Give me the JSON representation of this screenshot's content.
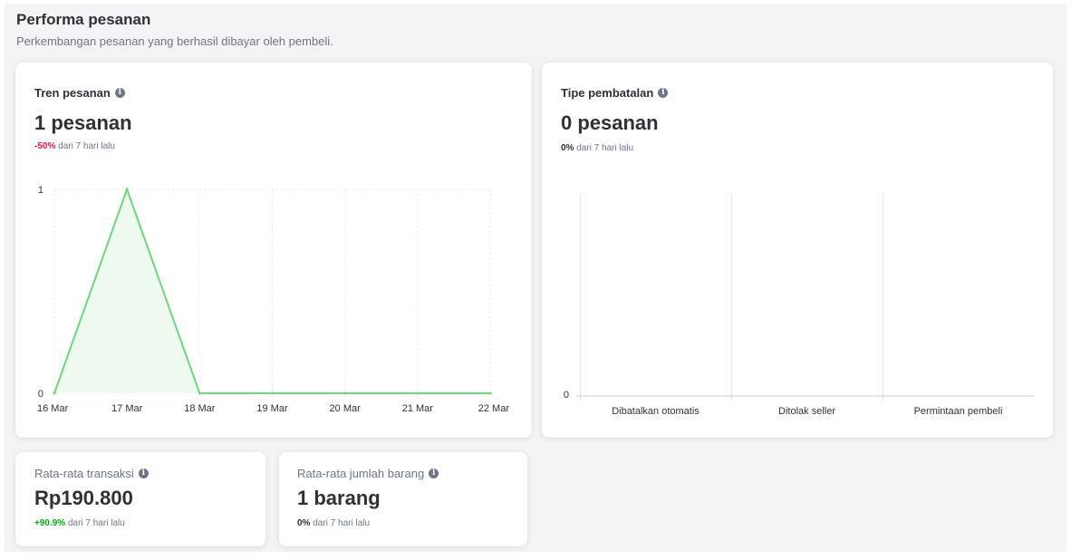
{
  "section": {
    "title": "Performa pesanan",
    "subtitle": "Perkembangan pesanan yang berhasil dibayar oleh pembeli."
  },
  "tren": {
    "title": "Tren pesanan",
    "value": "1 pesanan",
    "delta_pct": "-50%",
    "delta_text": " dari 7 hari lalu"
  },
  "pembatalan": {
    "title": "Tipe pembatalan",
    "value": "0 pesanan",
    "delta_pct": "0%",
    "delta_text": " dari 7 hari lalu"
  },
  "transaksi": {
    "title": "Rata-rata transaksi",
    "value": "Rp190.800",
    "delta_pct": "+90.9%",
    "delta_text": " dari 7 hari lalu"
  },
  "barang": {
    "title": "Rata-rata jumlah barang",
    "value": "1 barang",
    "delta_pct": "0%",
    "delta_text": " dari 7 hari lalu"
  },
  "info_icon_glyph": "i",
  "colors": {
    "line": "#6cd87a",
    "area": "#eefaf0",
    "negative": "#ef144a",
    "positive": "#03ac0e"
  },
  "chart_data": [
    {
      "type": "area",
      "x": [
        "16 Mar",
        "17 Mar",
        "18 Mar",
        "19 Mar",
        "20 Mar",
        "21 Mar",
        "22 Mar"
      ],
      "series": [
        {
          "values": [
            0,
            1,
            0,
            0,
            0,
            0,
            0
          ]
        }
      ],
      "yticks": [
        0,
        1
      ],
      "ylim": [
        0,
        1
      ],
      "grid": true
    },
    {
      "type": "bar",
      "categories": [
        "Dibatalkan otomatis",
        "Ditolak seller",
        "Permintaan pembeli"
      ],
      "values": [
        0,
        0,
        0
      ],
      "yticks": [
        0
      ],
      "grid": true
    }
  ]
}
